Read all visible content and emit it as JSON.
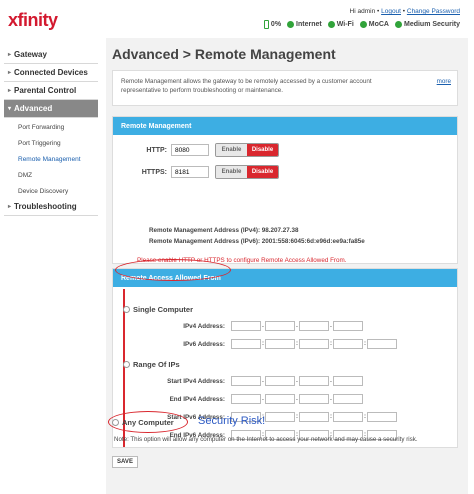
{
  "header": {
    "logo": "xfinity",
    "greeting": "Hi admin",
    "logout": "Logout",
    "change_password": "Change Password",
    "battery": "0%",
    "status": [
      "Internet",
      "Wi-Fi",
      "MoCA",
      "Medium Security"
    ]
  },
  "sidebar": {
    "items": [
      {
        "label": "Gateway"
      },
      {
        "label": "Connected Devices"
      },
      {
        "label": "Parental Control"
      },
      {
        "label": "Advanced"
      },
      {
        "label": "Troubleshooting"
      }
    ],
    "sub_items": [
      "Port Forwarding",
      "Port Triggering",
      "Remote Management",
      "DMZ",
      "Device Discovery"
    ]
  },
  "main": {
    "title": "Advanced > Remote Management",
    "description": "Remote Management allows the gateway to be remotely accessed by a customer account representative to perform troubleshooting or maintenance.",
    "more": "more",
    "remote_panel": {
      "heading": "Remote Management",
      "http_label": "HTTP:",
      "http_value": "8080",
      "https_label": "HTTPS:",
      "https_value": "8181",
      "enable": "Enable",
      "disable": "Disable",
      "ipv4_line": "Remote Management Address (IPv4): 98.207.27.38",
      "ipv6_line": "Remote Management Address (IPv6): 2001:558:6045:6d:e96d:ee9a:fa85e",
      "warning": "Please enable HTTP or HTTPS to configure Remote Access Allowed From."
    },
    "access_panel": {
      "heading": "Remote Access Allowed From",
      "single_computer": "Single Computer",
      "ipv4_address": "IPv4 Address:",
      "ipv6_address": "IPv6 Address:",
      "range_of_ips": "Range Of IPs",
      "start_ipv4": "Start IPv4 Address:",
      "end_ipv4": "End IPv4 Address:",
      "start_ipv6": "Start IPv6 Address:",
      "end_ipv6": "End IPv6 Address:",
      "any_computer": "Any Computer",
      "security_risk": "Security Risk!",
      "note": "Note: This option will allow any computer on the Internet to access your network and may cause a security risk."
    },
    "save": "SAVE"
  },
  "colors": {
    "brand": "#d3192f",
    "panel_header": "#3daee3",
    "danger": "#d9272e",
    "status_ok": "#31a33a"
  }
}
